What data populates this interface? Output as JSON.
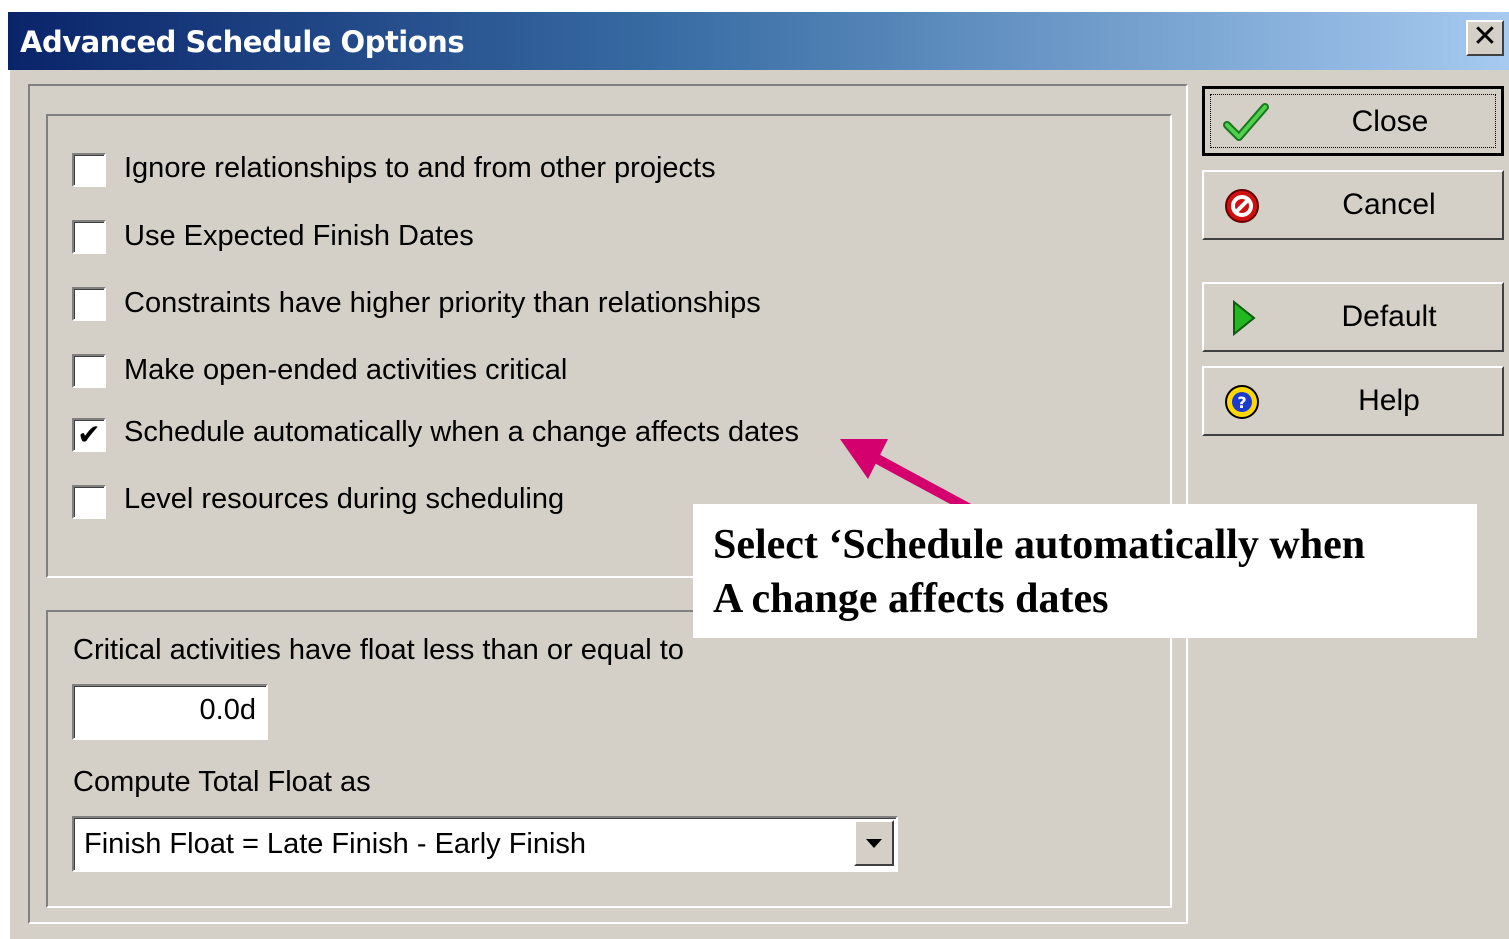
{
  "window": {
    "title": "Advanced Schedule Options",
    "close_glyph": "✕"
  },
  "options": [
    {
      "label": "Ignore relationships to and from other projects",
      "checked": false
    },
    {
      "label": "Use Expected Finish Dates",
      "checked": false
    },
    {
      "label": "Constraints have higher priority than relationships",
      "checked": false
    },
    {
      "label": "Make open-ended activities critical",
      "checked": false
    },
    {
      "label": "Schedule automatically when a change affects dates",
      "checked": true
    },
    {
      "label": "Level resources during scheduling",
      "checked": false
    }
  ],
  "float": {
    "critical_label": "Critical activities have float less than or equal to",
    "critical_value": "0.0d",
    "compute_label": "Compute Total Float as",
    "compute_value": "Finish Float = Late Finish - Early Finish"
  },
  "buttons": {
    "close": {
      "label": "Close",
      "icon": "checkmark-icon"
    },
    "cancel": {
      "label": "Cancel",
      "icon": "cancel-icon"
    },
    "default": {
      "label": "Default",
      "icon": "play-arrow-icon"
    },
    "help": {
      "label": "Help",
      "icon": "help-icon"
    }
  },
  "annotation": {
    "line1": "Select ‘Schedule automatically when",
    "line2": "A change affects dates",
    "arrow_color": "#d4006e"
  },
  "colors": {
    "dialog_bg": "#d4d0c8",
    "title_start": "#0a246a",
    "title_end": "#a6caf0"
  }
}
